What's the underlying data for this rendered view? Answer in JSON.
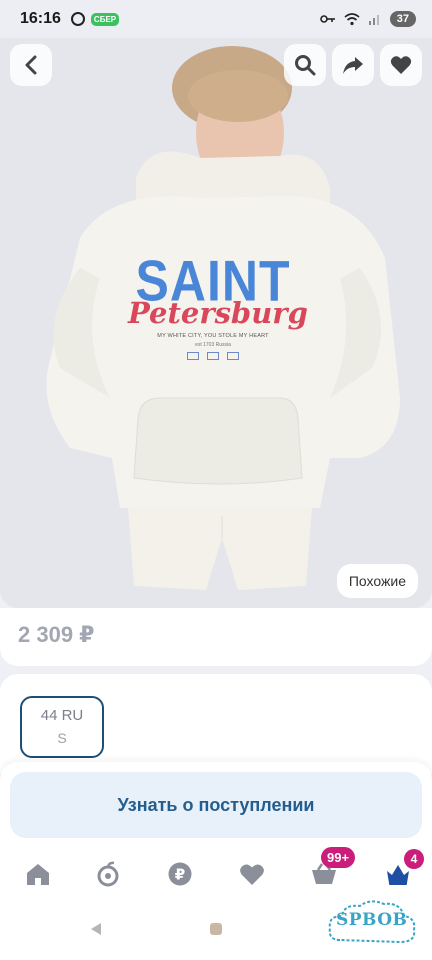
{
  "status_bar": {
    "time": "16:16",
    "notification_badge": "СБЕР",
    "battery": "37"
  },
  "image": {
    "print_line1": "SAINT",
    "print_line2": "Petersburg",
    "print_slogan": "MY WHITE CITY, YOU STOLE MY HEART",
    "print_est": "est 1703 Russia",
    "similar_label": "Похожие"
  },
  "product": {
    "price": "2 309 ₽"
  },
  "sizes": [
    {
      "ru": "44 RU",
      "intl": "S",
      "selected": true
    }
  ],
  "notify": {
    "label": "Узнать о поступлении"
  },
  "bottom_nav": {
    "cart_badge": "99+",
    "profile_badge": "4",
    "items": [
      "home-icon",
      "catalog-icon",
      "payments-icon",
      "favorites-icon",
      "cart-icon",
      "profile-icon"
    ]
  },
  "watermark": {
    "text": "SPBOB"
  },
  "colors": {
    "accent": "#245e8f",
    "notify_bg": "#e8f1fa",
    "badge": "#cb1e7b",
    "selected_border": "#1e4e73"
  }
}
